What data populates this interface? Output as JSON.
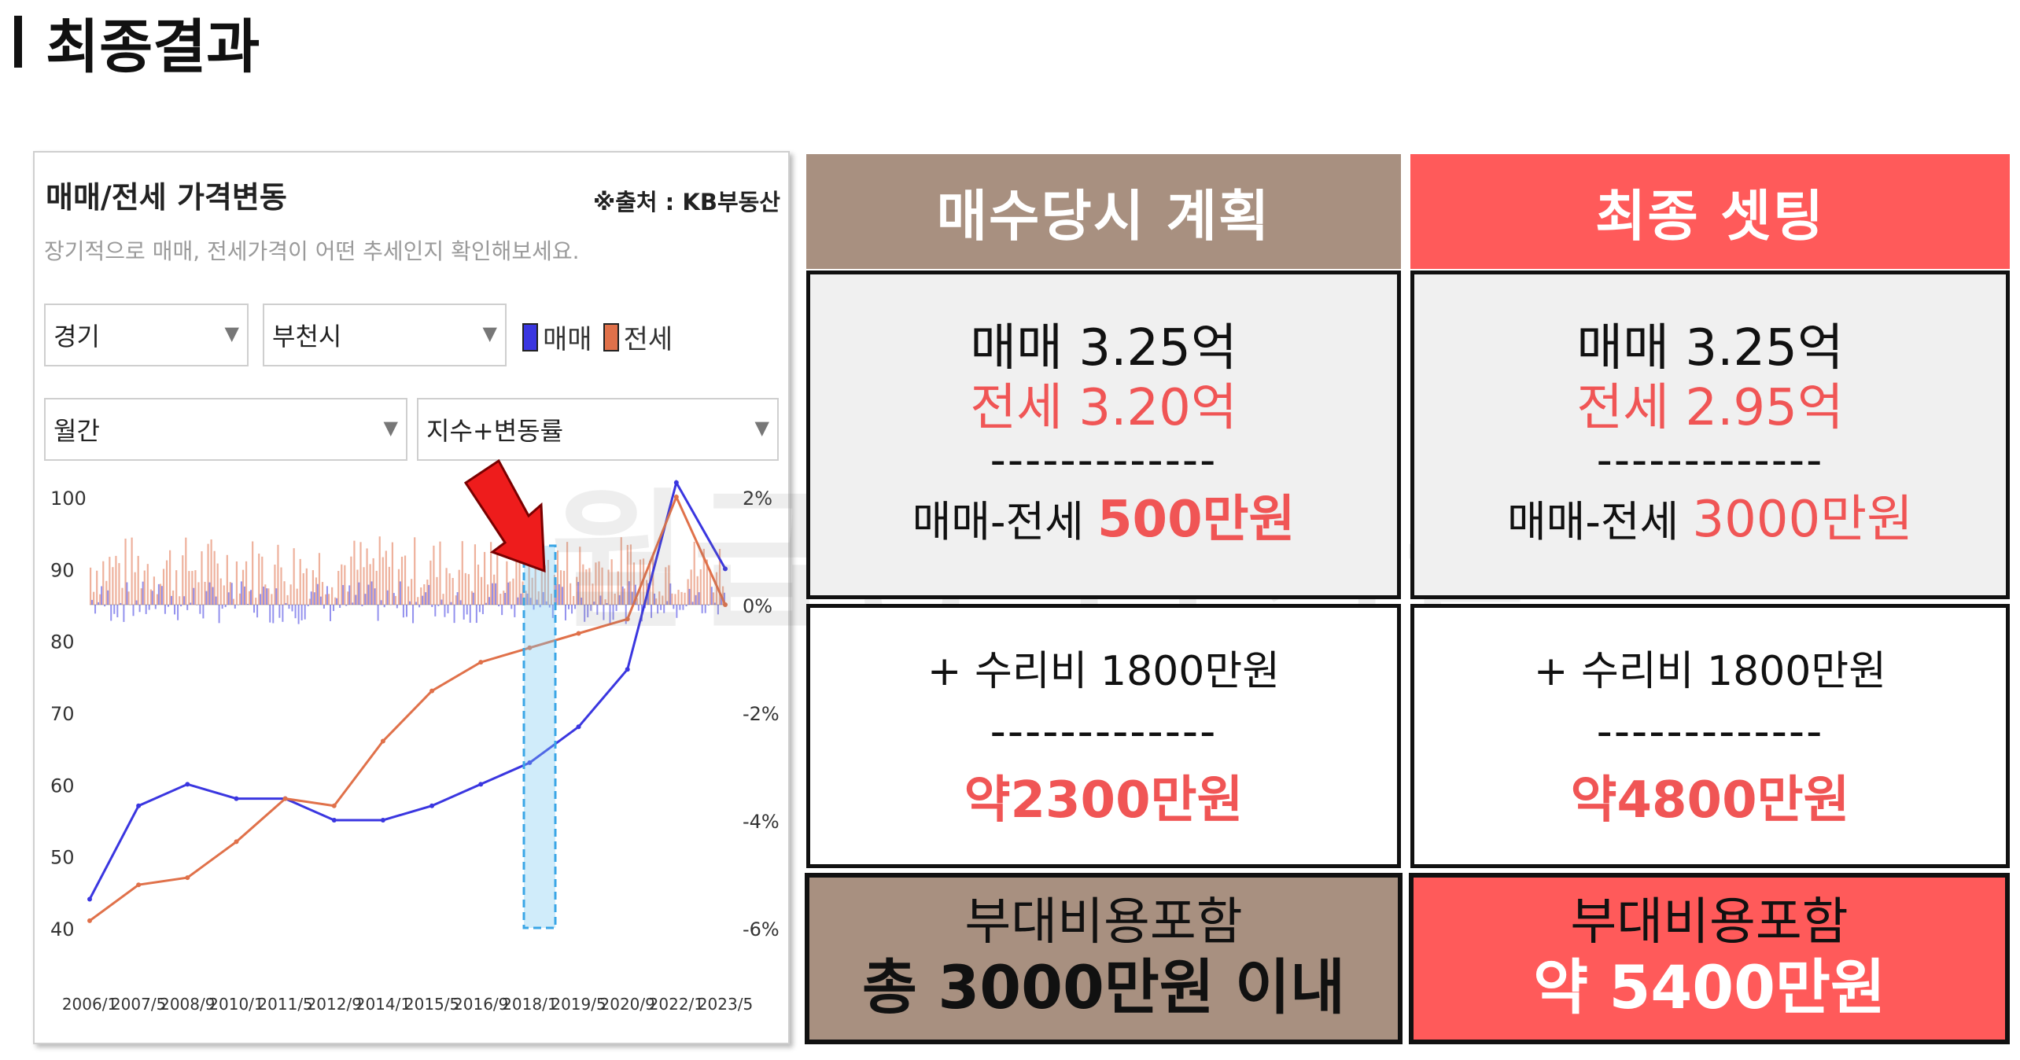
{
  "page": {
    "title": "최종결과",
    "watermark": "월급쟁이부자들"
  },
  "panel": {
    "title": "매매/전세 가격변동",
    "source": "※출처 : KB부동산",
    "subtitle": "장기적으로 매매, 전세가격이 어떤 추세인지 확인해보세요.",
    "region_select": "경기",
    "city_select": "부천시",
    "period_select": "월간",
    "mode_select": "지수+변동률",
    "legend": {
      "sale": "매매",
      "jeonse": "전세"
    }
  },
  "colors": {
    "sale": "#3a36e0",
    "jeonse": "#e0714a",
    "brown": "#a89080",
    "red": "#ff5a5a"
  },
  "chart_data": {
    "type": "line",
    "x": [
      "2006/1",
      "2007/5",
      "2008/9",
      "2010/1",
      "2011/5",
      "2012/9",
      "2014/1",
      "2015/5",
      "2016/9",
      "2018/1",
      "2019/5",
      "2020/9",
      "2022/1",
      "2023/5"
    ],
    "ylim": [
      40,
      100
    ],
    "y_ticks": [
      "100",
      "90",
      "80",
      "70",
      "60",
      "50",
      "40"
    ],
    "y2lim": [
      -6,
      2
    ],
    "y2_ticks": [
      "2%",
      "0%",
      "-2%",
      "-4%",
      "-6%"
    ],
    "series": [
      {
        "name": "매매",
        "values": [
          44,
          57,
          60,
          58,
          58,
          55,
          55,
          57,
          60,
          63,
          68,
          76,
          102,
          90
        ]
      },
      {
        "name": "전세",
        "values": [
          41,
          46,
          47,
          52,
          58,
          57,
          66,
          73,
          77,
          79,
          81,
          83,
          100,
          85
        ]
      }
    ]
  },
  "plan": {
    "header": "매수당시 계획",
    "sale": "매매 3.25억",
    "jeonse": "전세 3.20억",
    "divider": "-------------",
    "gap_label": "매매-전세 ",
    "gap_value": "500만원",
    "repair": "+ 수리비 1800만원",
    "divider2": "-------------",
    "total": "약2300만원",
    "footer_l1": "부대비용포함",
    "footer_l2": "총 3000만원 이내"
  },
  "final": {
    "header": "최종 셋팅",
    "sale": "매매 3.25억",
    "jeonse": "전세 2.95억",
    "divider": "-------------",
    "gap_label": "매매-전세 ",
    "gap_value": "3000만원",
    "repair": "+ 수리비 1800만원",
    "divider2": "-------------",
    "total": "약4800만원",
    "footer_l1": "부대비용포함",
    "footer_l2": "약 5400만원"
  }
}
